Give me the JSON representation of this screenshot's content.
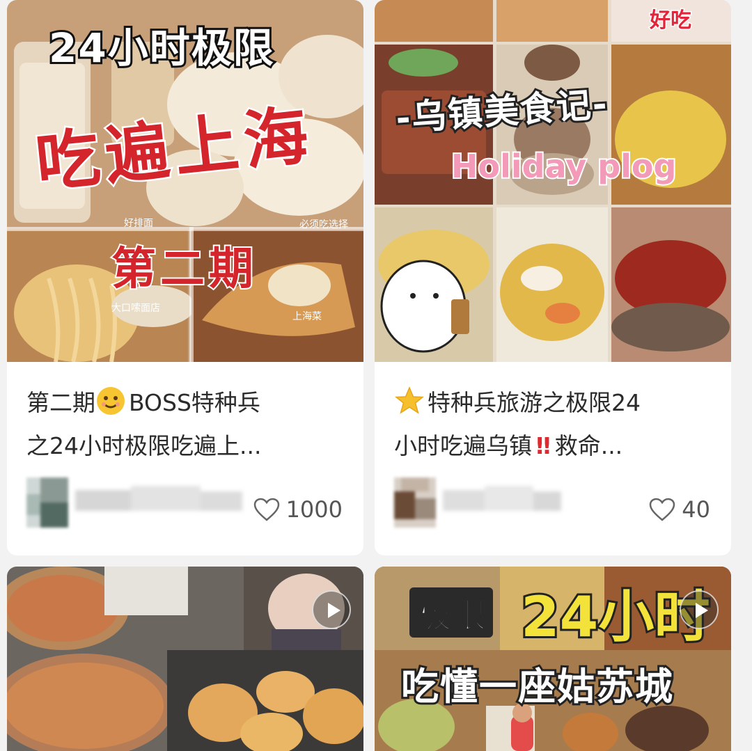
{
  "cards": [
    {
      "cover": {
        "line1": "24小时极限",
        "line2": "吃遍上海",
        "line3": "第二期",
        "tags": [
          "好排面",
          "必须吃选择",
          "大口嗦面店",
          "上海菜"
        ]
      },
      "title_line1": "第二期",
      "title_line1_rest": "BOSS特种兵",
      "title_line2": "之24小时极限吃遍上...",
      "emoji_icon": "smiling-face-emoji",
      "likes": "1000"
    },
    {
      "cover": {
        "headline": "-乌镇美食记-",
        "sub": "Holiday plog",
        "corner": "好吃"
      },
      "title_star_icon": "star-emoji",
      "title_line1": "特种兵旅游之极限24",
      "title_line2_a": "小时吃遍乌镇",
      "title_bang": "‼",
      "title_line2_b": "救命...",
      "likes": "40"
    },
    {
      "cover": {
        "type": "video",
        "icon": "play-icon"
      }
    },
    {
      "cover": {
        "type": "video",
        "badge": "极限",
        "line1": "24小时",
        "line2": "吃懂一座姑苏城",
        "icon": "play-icon"
      }
    }
  ],
  "colors": {
    "background": "#f2f2f2",
    "card": "#ffffff",
    "title": "#2b2b2b",
    "likes": "#555555",
    "accent_red": "#d3252b"
  }
}
